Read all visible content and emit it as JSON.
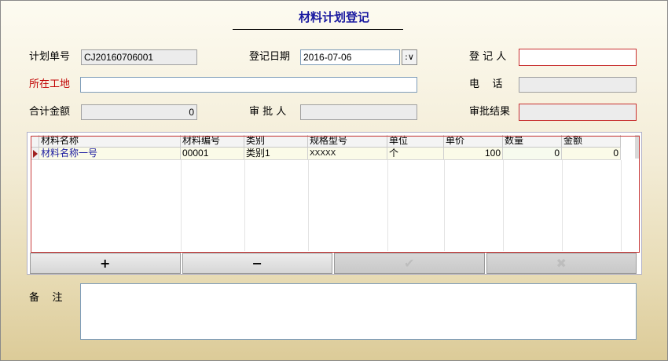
{
  "title": "材料计划登记",
  "form": {
    "plan_no_label": "计划单号",
    "plan_no": "CJ20160706001",
    "reg_date_label": "登记日期",
    "reg_date": "2016-07-06",
    "registrant_label": "登 记 人",
    "registrant": "",
    "site_label": "所在工地",
    "site": "",
    "phone_label": "电    话",
    "phone": "",
    "total_label": "合计金额",
    "total": "0",
    "approver_label": "审 批 人",
    "approver": "",
    "result_label": "审批结果",
    "result": "",
    "remark_label": "备    注",
    "remark": ""
  },
  "grid": {
    "columns": [
      "材料名称",
      "材料编号",
      "类别",
      "规格型号",
      "单位",
      "单价",
      "数量",
      "金额"
    ],
    "rows": [
      [
        "材料名称一号",
        "00001",
        "类别1",
        "XXXXX",
        "个",
        "100",
        "0",
        "0"
      ]
    ]
  },
  "toolbar": {
    "add": "+",
    "remove": "−",
    "confirm": "✔",
    "cancel": "✖"
  },
  "colors": {
    "title": "#1a1aa0",
    "required_label": "#c00000",
    "required_border": "#c83030"
  }
}
